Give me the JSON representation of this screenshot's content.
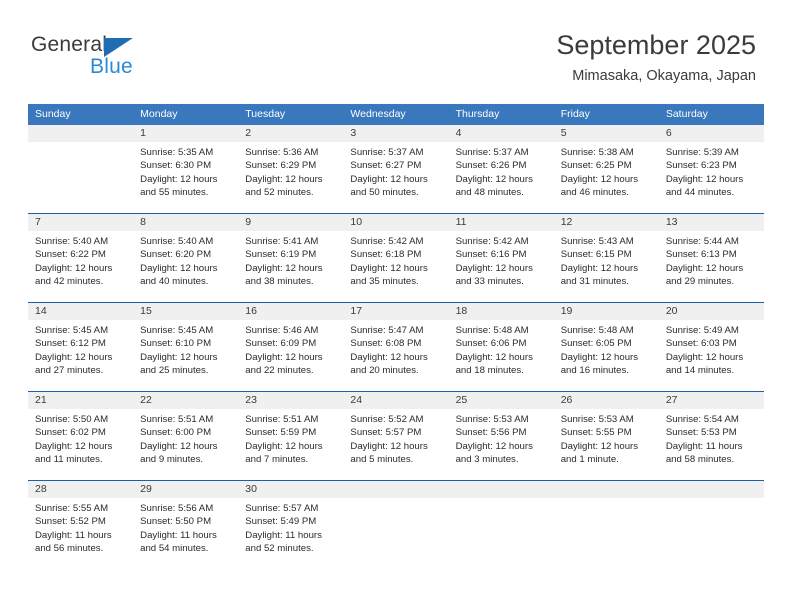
{
  "brand": {
    "name_part1": "General",
    "name_part2": "Blue",
    "color_dark": "#3b3b3b",
    "color_blue": "#2b8ad6",
    "triangle_color": "#1f6cb4"
  },
  "header": {
    "month_title": "September 2025",
    "location": "Mimasaka, Okayama, Japan"
  },
  "calendar": {
    "header_bg": "#3a78bd",
    "header_text_color": "#ffffff",
    "row_divider_color": "#1a5fa8",
    "daynum_band_bg": "#f0f0f0",
    "weekdays": [
      "Sunday",
      "Monday",
      "Tuesday",
      "Wednesday",
      "Thursday",
      "Friday",
      "Saturday"
    ],
    "weeks": [
      [
        {
          "day": "",
          "lines": []
        },
        {
          "day": "1",
          "lines": [
            "Sunrise: 5:35 AM",
            "Sunset: 6:30 PM",
            "Daylight: 12 hours",
            "and 55 minutes."
          ]
        },
        {
          "day": "2",
          "lines": [
            "Sunrise: 5:36 AM",
            "Sunset: 6:29 PM",
            "Daylight: 12 hours",
            "and 52 minutes."
          ]
        },
        {
          "day": "3",
          "lines": [
            "Sunrise: 5:37 AM",
            "Sunset: 6:27 PM",
            "Daylight: 12 hours",
            "and 50 minutes."
          ]
        },
        {
          "day": "4",
          "lines": [
            "Sunrise: 5:37 AM",
            "Sunset: 6:26 PM",
            "Daylight: 12 hours",
            "and 48 minutes."
          ]
        },
        {
          "day": "5",
          "lines": [
            "Sunrise: 5:38 AM",
            "Sunset: 6:25 PM",
            "Daylight: 12 hours",
            "and 46 minutes."
          ]
        },
        {
          "day": "6",
          "lines": [
            "Sunrise: 5:39 AM",
            "Sunset: 6:23 PM",
            "Daylight: 12 hours",
            "and 44 minutes."
          ]
        }
      ],
      [
        {
          "day": "7",
          "lines": [
            "Sunrise: 5:40 AM",
            "Sunset: 6:22 PM",
            "Daylight: 12 hours",
            "and 42 minutes."
          ]
        },
        {
          "day": "8",
          "lines": [
            "Sunrise: 5:40 AM",
            "Sunset: 6:20 PM",
            "Daylight: 12 hours",
            "and 40 minutes."
          ]
        },
        {
          "day": "9",
          "lines": [
            "Sunrise: 5:41 AM",
            "Sunset: 6:19 PM",
            "Daylight: 12 hours",
            "and 38 minutes."
          ]
        },
        {
          "day": "10",
          "lines": [
            "Sunrise: 5:42 AM",
            "Sunset: 6:18 PM",
            "Daylight: 12 hours",
            "and 35 minutes."
          ]
        },
        {
          "day": "11",
          "lines": [
            "Sunrise: 5:42 AM",
            "Sunset: 6:16 PM",
            "Daylight: 12 hours",
            "and 33 minutes."
          ]
        },
        {
          "day": "12",
          "lines": [
            "Sunrise: 5:43 AM",
            "Sunset: 6:15 PM",
            "Daylight: 12 hours",
            "and 31 minutes."
          ]
        },
        {
          "day": "13",
          "lines": [
            "Sunrise: 5:44 AM",
            "Sunset: 6:13 PM",
            "Daylight: 12 hours",
            "and 29 minutes."
          ]
        }
      ],
      [
        {
          "day": "14",
          "lines": [
            "Sunrise: 5:45 AM",
            "Sunset: 6:12 PM",
            "Daylight: 12 hours",
            "and 27 minutes."
          ]
        },
        {
          "day": "15",
          "lines": [
            "Sunrise: 5:45 AM",
            "Sunset: 6:10 PM",
            "Daylight: 12 hours",
            "and 25 minutes."
          ]
        },
        {
          "day": "16",
          "lines": [
            "Sunrise: 5:46 AM",
            "Sunset: 6:09 PM",
            "Daylight: 12 hours",
            "and 22 minutes."
          ]
        },
        {
          "day": "17",
          "lines": [
            "Sunrise: 5:47 AM",
            "Sunset: 6:08 PM",
            "Daylight: 12 hours",
            "and 20 minutes."
          ]
        },
        {
          "day": "18",
          "lines": [
            "Sunrise: 5:48 AM",
            "Sunset: 6:06 PM",
            "Daylight: 12 hours",
            "and 18 minutes."
          ]
        },
        {
          "day": "19",
          "lines": [
            "Sunrise: 5:48 AM",
            "Sunset: 6:05 PM",
            "Daylight: 12 hours",
            "and 16 minutes."
          ]
        },
        {
          "day": "20",
          "lines": [
            "Sunrise: 5:49 AM",
            "Sunset: 6:03 PM",
            "Daylight: 12 hours",
            "and 14 minutes."
          ]
        }
      ],
      [
        {
          "day": "21",
          "lines": [
            "Sunrise: 5:50 AM",
            "Sunset: 6:02 PM",
            "Daylight: 12 hours",
            "and 11 minutes."
          ]
        },
        {
          "day": "22",
          "lines": [
            "Sunrise: 5:51 AM",
            "Sunset: 6:00 PM",
            "Daylight: 12 hours",
            "and 9 minutes."
          ]
        },
        {
          "day": "23",
          "lines": [
            "Sunrise: 5:51 AM",
            "Sunset: 5:59 PM",
            "Daylight: 12 hours",
            "and 7 minutes."
          ]
        },
        {
          "day": "24",
          "lines": [
            "Sunrise: 5:52 AM",
            "Sunset: 5:57 PM",
            "Daylight: 12 hours",
            "and 5 minutes."
          ]
        },
        {
          "day": "25",
          "lines": [
            "Sunrise: 5:53 AM",
            "Sunset: 5:56 PM",
            "Daylight: 12 hours",
            "and 3 minutes."
          ]
        },
        {
          "day": "26",
          "lines": [
            "Sunrise: 5:53 AM",
            "Sunset: 5:55 PM",
            "Daylight: 12 hours",
            "and 1 minute."
          ]
        },
        {
          "day": "27",
          "lines": [
            "Sunrise: 5:54 AM",
            "Sunset: 5:53 PM",
            "Daylight: 11 hours",
            "and 58 minutes."
          ]
        }
      ],
      [
        {
          "day": "28",
          "lines": [
            "Sunrise: 5:55 AM",
            "Sunset: 5:52 PM",
            "Daylight: 11 hours",
            "and 56 minutes."
          ]
        },
        {
          "day": "29",
          "lines": [
            "Sunrise: 5:56 AM",
            "Sunset: 5:50 PM",
            "Daylight: 11 hours",
            "and 54 minutes."
          ]
        },
        {
          "day": "30",
          "lines": [
            "Sunrise: 5:57 AM",
            "Sunset: 5:49 PM",
            "Daylight: 11 hours",
            "and 52 minutes."
          ]
        },
        {
          "day": "",
          "lines": []
        },
        {
          "day": "",
          "lines": []
        },
        {
          "day": "",
          "lines": []
        },
        {
          "day": "",
          "lines": []
        }
      ]
    ]
  }
}
